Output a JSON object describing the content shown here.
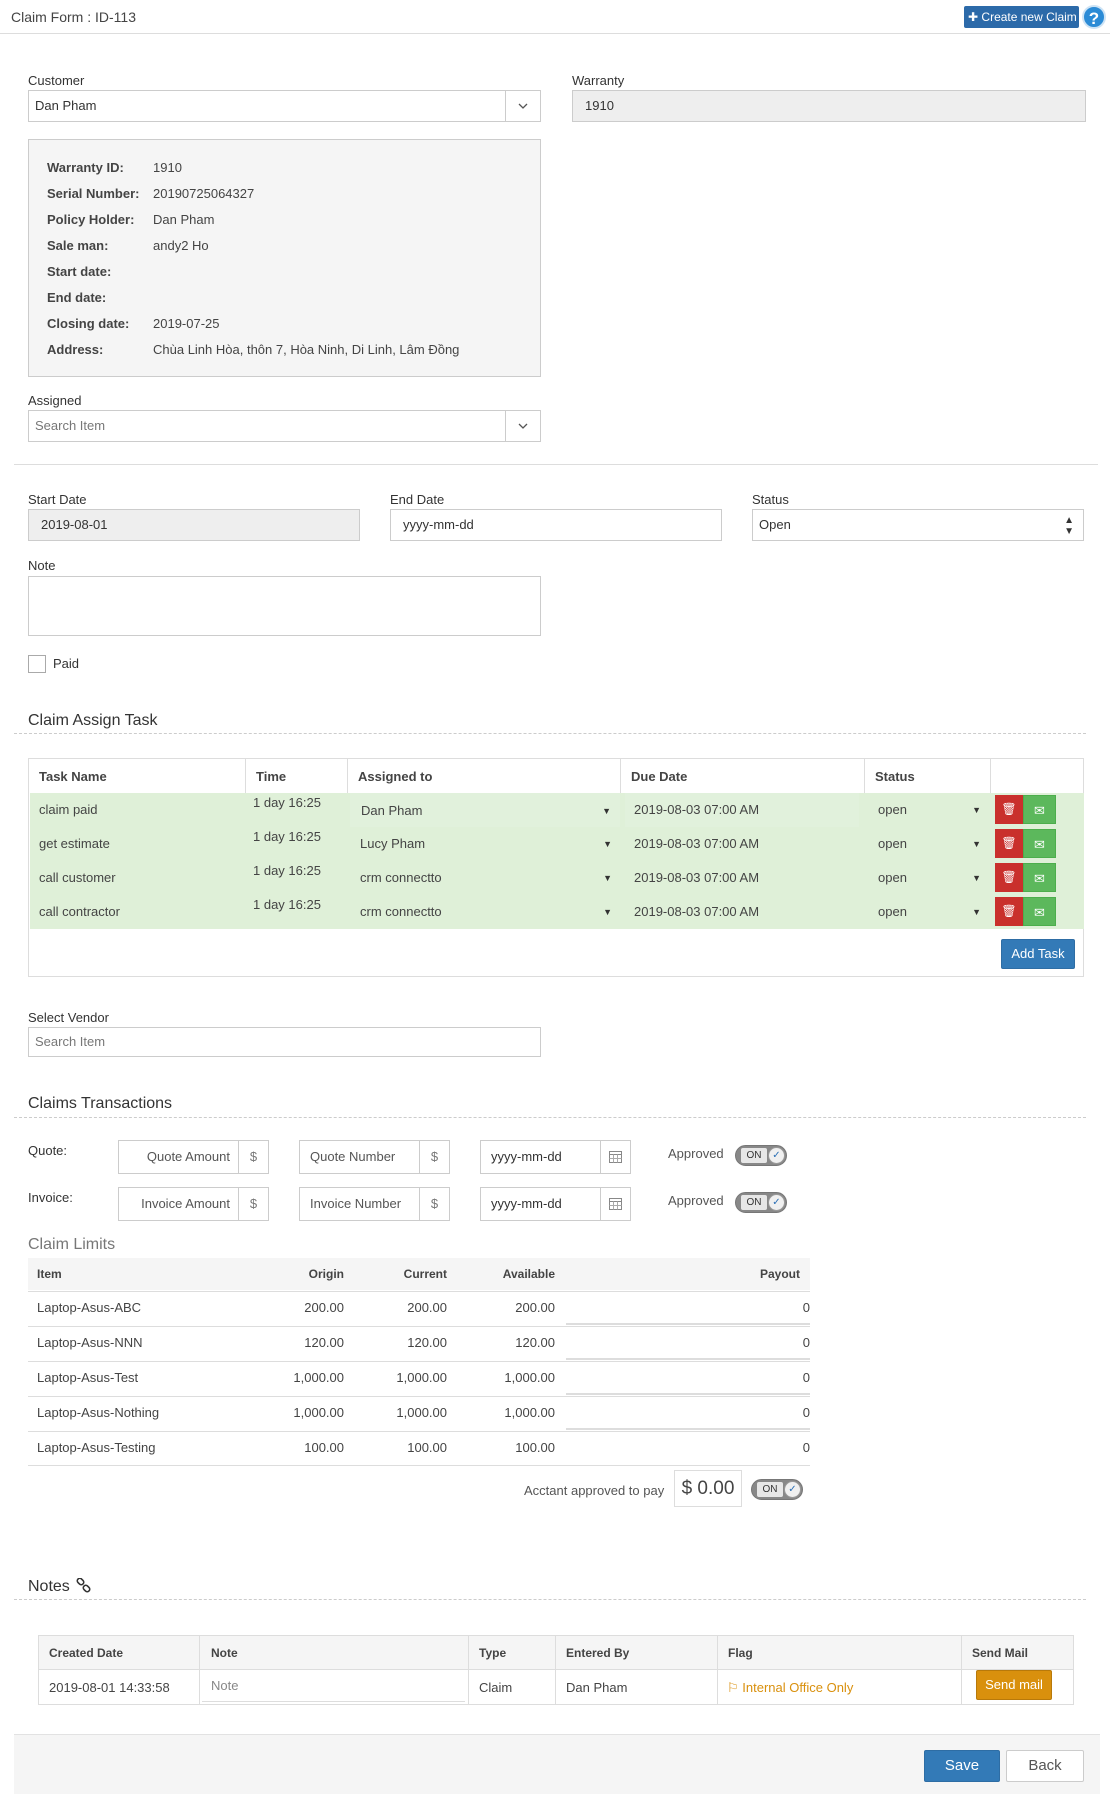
{
  "header": {
    "title": "Claim Form : ID-113",
    "create_label": "Create new Claim",
    "help": "?"
  },
  "customer": {
    "label": "Customer",
    "value": "Dan Pham"
  },
  "warranty": {
    "label": "Warranty",
    "value": "1910"
  },
  "info": {
    "rows": [
      {
        "key": "Warranty ID:",
        "value": "1910"
      },
      {
        "key": "Serial Number:",
        "value": "20190725064327"
      },
      {
        "key": "Policy Holder:",
        "value": "Dan Pham"
      },
      {
        "key": "Sale man:",
        "value": "andy2 Ho"
      },
      {
        "key": "Start date:",
        "value": ""
      },
      {
        "key": "End date:",
        "value": ""
      },
      {
        "key": "Closing date:",
        "value": "2019-07-25"
      },
      {
        "key": "Address:",
        "value": "Chùa Linh Hòa, thôn 7, Hòa Ninh, Di Linh, Lâm Đồng"
      }
    ]
  },
  "assigned": {
    "label": "Assigned",
    "placeholder": "Search Item"
  },
  "dates": {
    "start_label": "Start Date",
    "start_value": "2019-08-01",
    "end_label": "End Date",
    "end_placeholder": "yyyy-mm-dd",
    "status_label": "Status",
    "status_value": "Open"
  },
  "note": {
    "label": "Note",
    "value": ""
  },
  "paid": {
    "label": "Paid"
  },
  "tasks": {
    "title": "Claim Assign Task",
    "headers": [
      "Task Name",
      "Time",
      "Assigned to",
      "Due Date",
      "Status"
    ],
    "rows": [
      {
        "name": "claim paid",
        "time": "1 day 16:25",
        "assigned": "Dan Pham",
        "due": "2019-08-03 07:00 AM",
        "status": "open"
      },
      {
        "name": "get estimate",
        "time": "1 day 16:25",
        "assigned": "Lucy Pham",
        "due": "2019-08-03 07:00 AM",
        "status": "open"
      },
      {
        "name": "call customer",
        "time": "1 day 16:25",
        "assigned": "crm connectto",
        "due": "2019-08-03 07:00 AM",
        "status": "open"
      },
      {
        "name": "call contractor",
        "time": "1 day 16:25",
        "assigned": "crm connectto",
        "due": "2019-08-03 07:00 AM",
        "status": "open"
      }
    ],
    "add_label": "Add Task"
  },
  "vendor": {
    "label": "Select Vendor",
    "placeholder": "Search Item"
  },
  "transactions": {
    "title": "Claims Transactions",
    "quote_label": "Quote:",
    "invoice_label": "Invoice:",
    "quote_amount_ph": "Quote Amount",
    "quote_number_ph": "Quote Number",
    "invoice_amount_ph": "Invoice Amount",
    "invoice_number_ph": "Invoice Number",
    "currency": "$",
    "date_ph": "yyyy-mm-dd",
    "approved_label": "Approved",
    "toggle_on": "ON"
  },
  "limits": {
    "title": "Claim Limits",
    "headers": [
      "Item",
      "Origin",
      "Current",
      "Available",
      "Payout"
    ],
    "rows": [
      {
        "item": "Laptop-Asus-ABC",
        "origin": "200.00",
        "current": "200.00",
        "available": "200.00",
        "payout": "0"
      },
      {
        "item": "Laptop-Asus-NNN",
        "origin": "120.00",
        "current": "120.00",
        "available": "120.00",
        "payout": "0"
      },
      {
        "item": "Laptop-Asus-Test",
        "origin": "1,000.00",
        "current": "1,000.00",
        "available": "1,000.00",
        "payout": "0"
      },
      {
        "item": "Laptop-Asus-Nothing",
        "origin": "1,000.00",
        "current": "1,000.00",
        "available": "1,000.00",
        "payout": "0"
      },
      {
        "item": "Laptop-Asus-Testing",
        "origin": "100.00",
        "current": "100.00",
        "available": "100.00",
        "payout": "0"
      }
    ],
    "acctant_label": "Acctant approved to pay",
    "acctant_value": "$ 0.00"
  },
  "notes": {
    "title": "Notes",
    "headers": [
      "Created Date",
      "Note",
      "Type",
      "Entered By",
      "Flag",
      "Send Mail"
    ],
    "row": {
      "created": "2019-08-01 14:33:58",
      "note_ph": "Note",
      "type": "Claim",
      "entered_by": "Dan Pham",
      "flag": "Internal Office Only",
      "send_label": "Send mail"
    }
  },
  "footer": {
    "save": "Save",
    "back": "Back"
  },
  "colors": {
    "primary": "#337ab7",
    "danger": "#c9302c",
    "success": "#5cb85c",
    "warning": "#d9900d",
    "row_success": "#dff0d8"
  }
}
